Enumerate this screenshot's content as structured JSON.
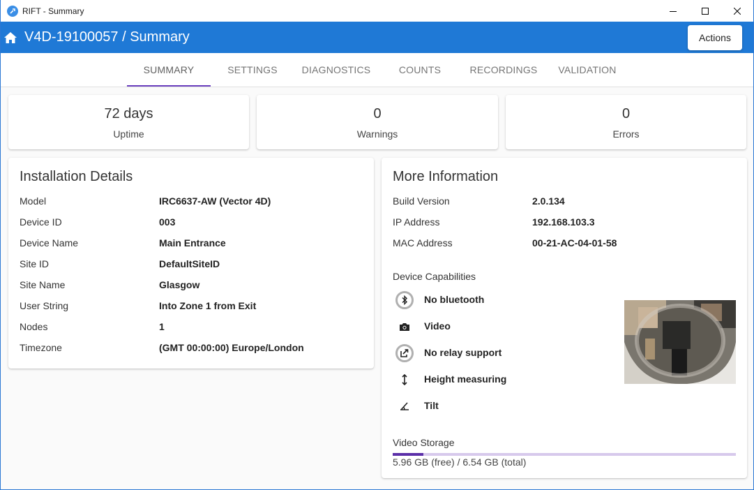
{
  "window": {
    "title": "RIFT - Summary"
  },
  "appbar": {
    "title": "V4D-19100057 / Summary",
    "actions_label": "Actions"
  },
  "tabs": [
    {
      "label": "SUMMARY",
      "active": true
    },
    {
      "label": "SETTINGS",
      "active": false
    },
    {
      "label": "DIAGNOSTICS",
      "active": false
    },
    {
      "label": "COUNTS",
      "active": false
    },
    {
      "label": "RECORDINGS",
      "active": false
    },
    {
      "label": "VALIDATION",
      "active": false
    }
  ],
  "stats": {
    "uptime": {
      "value": "72 days",
      "label": "Uptime"
    },
    "warnings": {
      "value": "0",
      "label": "Warnings"
    },
    "errors": {
      "value": "0",
      "label": "Errors"
    }
  },
  "installation": {
    "title": "Installation Details",
    "rows": [
      {
        "key": "Model",
        "value": "IRC6637-AW (Vector 4D)"
      },
      {
        "key": "Device ID",
        "value": "003"
      },
      {
        "key": "Device Name",
        "value": "Main Entrance"
      },
      {
        "key": "Site ID",
        "value": "DefaultSiteID"
      },
      {
        "key": "Site Name",
        "value": "Glasgow"
      },
      {
        "key": "User String",
        "value": "Into Zone 1 from Exit"
      },
      {
        "key": "Nodes",
        "value": "1"
      },
      {
        "key": "Timezone",
        "value": "(GMT 00:00:00) Europe/London"
      }
    ]
  },
  "more_info": {
    "title": "More Information",
    "rows": [
      {
        "key": "Build Version",
        "value": "2.0.134"
      },
      {
        "key": "IP Address",
        "value": "192.168.103.3"
      },
      {
        "key": "MAC Address",
        "value": "00-21-AC-04-01-58"
      }
    ],
    "capabilities_label": "Device Capabilities",
    "capabilities": [
      {
        "icon": "bluetooth-icon",
        "label": "No bluetooth"
      },
      {
        "icon": "camera-icon",
        "label": "Video"
      },
      {
        "icon": "relay-icon",
        "label": "No relay support"
      },
      {
        "icon": "height-icon",
        "label": "Height measuring"
      },
      {
        "icon": "tilt-icon",
        "label": "Tilt"
      }
    ],
    "storage": {
      "label": "Video Storage",
      "text": "5.96 GB (free) / 6.54 GB (total)",
      "used_fraction": 0.09
    }
  },
  "colors": {
    "appbar": "#1f79d6",
    "tab_indicator": "#6a3fbf",
    "storage_fill": "#5b2fa8",
    "storage_track": "#d7c9ec"
  }
}
